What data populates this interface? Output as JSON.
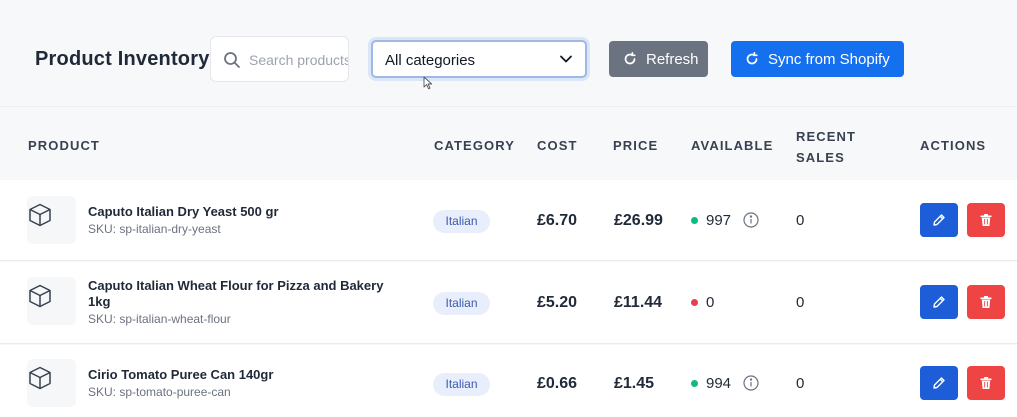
{
  "header": {
    "title": "Product Inventory",
    "search_placeholder": "Search products...",
    "category_selected": "All categories",
    "refresh_label": "Refresh",
    "sync_label": "Sync from Shopify"
  },
  "table": {
    "columns": {
      "product": "PRODUCT",
      "category": "CATEGORY",
      "cost": "COST",
      "price": "PRICE",
      "available": "AVAILABLE",
      "recent_sales_line1": "RECENT",
      "recent_sales_line2": "SALES",
      "actions": "ACTIONS"
    },
    "rows": [
      {
        "name": "Caputo Italian Dry Yeast 500 gr",
        "sku": "SKU: sp-italian-dry-yeast",
        "category": "Italian",
        "cost": "£6.70",
        "price": "£26.99",
        "available": "997",
        "stock_status": "in-stock",
        "recent_sales": "0"
      },
      {
        "name": "Caputo Italian Wheat Flour for Pizza and Bakery 1kg",
        "sku": "SKU: sp-italian-wheat-flour",
        "category": "Italian",
        "cost": "£5.20",
        "price": "£11.44",
        "available": "0",
        "stock_status": "out-of-stock",
        "recent_sales": "0"
      },
      {
        "name": "Cirio Tomato Puree Can 140gr",
        "sku": "SKU: sp-tomato-puree-can",
        "category": "Italian",
        "cost": "£0.66",
        "price": "£1.45",
        "available": "994",
        "stock_status": "in-stock",
        "recent_sales": "0"
      }
    ]
  },
  "colors": {
    "primary": "#1570ef",
    "secondary": "#6b7280",
    "edit": "#1d5ed8",
    "delete": "#ef4444",
    "in_stock": "#10b981",
    "out_of_stock": "#e0424f"
  },
  "icons": [
    "search-icon",
    "chevron-down-icon",
    "refresh-icon",
    "sync-icon",
    "box-icon",
    "info-icon",
    "pencil-icon",
    "trash-icon"
  ]
}
